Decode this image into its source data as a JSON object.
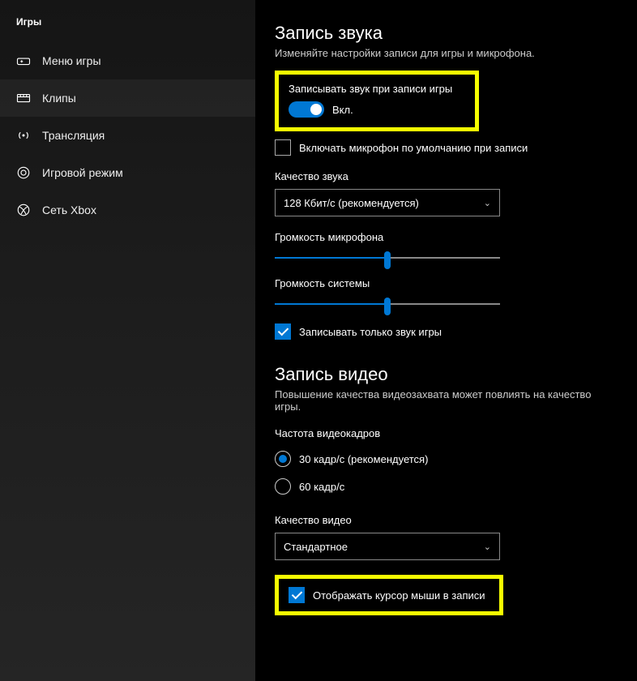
{
  "sidebar": {
    "title": "Игры",
    "items": [
      {
        "label": "Меню игры"
      },
      {
        "label": "Клипы"
      },
      {
        "label": "Трансляция"
      },
      {
        "label": "Игровой режим"
      },
      {
        "label": "Сеть Xbox"
      }
    ],
    "selected_index": 1
  },
  "audio": {
    "heading": "Запись звука",
    "sub": "Изменяйте настройки записи для игры и микрофона.",
    "record_audio_label": "Записывать звук при записи игры",
    "toggle_state": "Вкл.",
    "mic_checkbox_label": "Включать микрофон по умолчанию при записи",
    "mic_checkbox_checked": false,
    "quality_label": "Качество звука",
    "quality_value": "128 Кбит/с (рекомендуется)",
    "mic_volume_label": "Громкость микрофона",
    "mic_volume_percent": 50,
    "sys_volume_label": "Громкость системы",
    "sys_volume_percent": 50,
    "game_only_label": "Записывать только звук игры",
    "game_only_checked": true
  },
  "video": {
    "heading": "Запись видео",
    "sub": "Повышение качества видеозахвата может повлиять на качество игры.",
    "fps_label": "Частота видеокадров",
    "fps_options": [
      {
        "label": "30 кадр/с (рекомендуется)",
        "selected": true
      },
      {
        "label": "60 кадр/с",
        "selected": false
      }
    ],
    "quality_label": "Качество видео",
    "quality_value": "Стандартное",
    "cursor_label": "Отображать курсор мыши в записи",
    "cursor_checked": true
  }
}
